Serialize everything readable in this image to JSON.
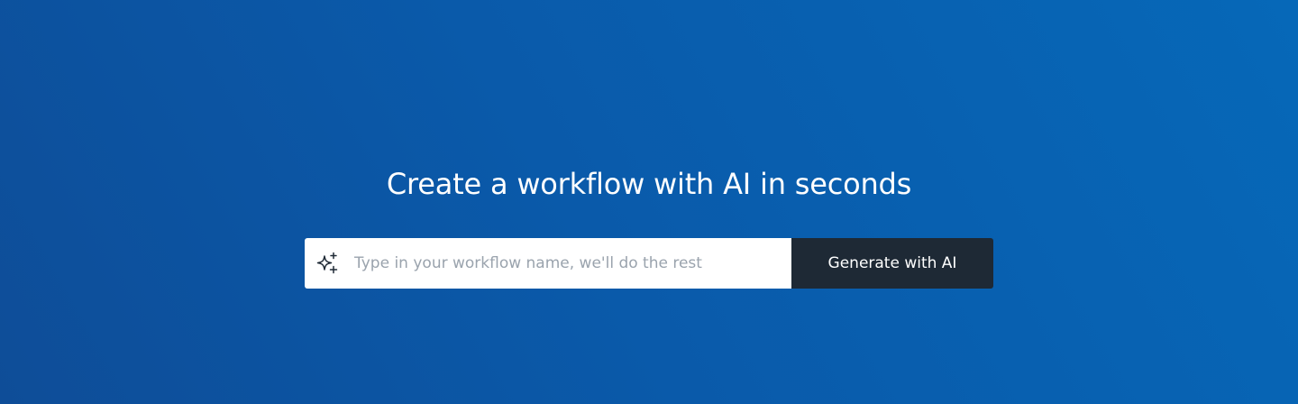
{
  "hero": {
    "headline": "Create a workflow with AI in seconds",
    "icon": "sparkles-icon",
    "input": {
      "value": "",
      "placeholder": "Type in your workflow name, we'll do the rest"
    },
    "generate_label": "Generate with AI"
  },
  "colors": {
    "background_start": "#0e4d98",
    "background_end": "#0668b8",
    "input_background": "#ffffff",
    "button_background": "#1e2935",
    "text_on_dark": "#ffffff",
    "placeholder": "#9aa3ad"
  }
}
